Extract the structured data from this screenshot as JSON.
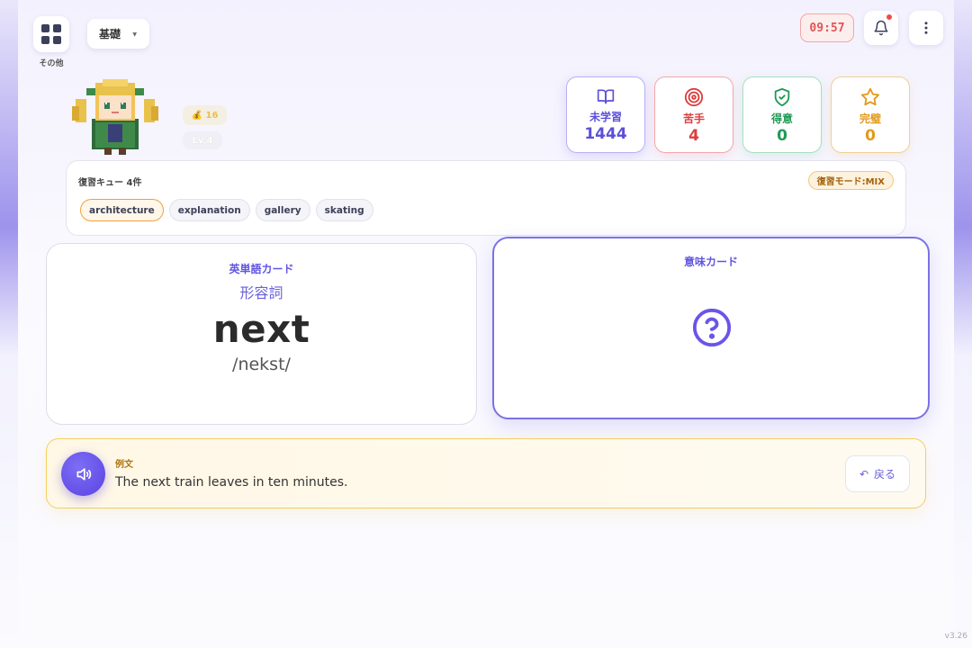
{
  "topbar": {
    "apps_label": "その他",
    "level": "基礎",
    "timer": "09:57"
  },
  "player": {
    "coins": "💰 16",
    "level": "Lv.4"
  },
  "stats": [
    {
      "label": "未学習",
      "value": "1444",
      "icon": "book-icon",
      "color": "#5b4fd8"
    },
    {
      "label": "苦手",
      "value": "4",
      "icon": "target-icon",
      "color": "#dc3d3d"
    },
    {
      "label": "得意",
      "value": "0",
      "icon": "shield-check-icon",
      "color": "#1f9a55"
    },
    {
      "label": "完璧",
      "value": "0",
      "icon": "star-icon",
      "color": "#e39a1a"
    }
  ],
  "queue": {
    "title": "復習キュー 4件",
    "mode": "復習モード:MIX",
    "words": [
      "architecture",
      "explanation",
      "gallery",
      "skating"
    ]
  },
  "word_card": {
    "heading": "英単語カード",
    "pos": "形容詞",
    "word": "next",
    "ipa": "/nekst/"
  },
  "meaning_card": {
    "heading": "意味カード"
  },
  "example": {
    "label": "例文",
    "text": "The next train leaves in ten minutes.",
    "back_label": "戻る"
  },
  "version": "v3.26",
  "colors": {
    "accent": "#6156e0",
    "timer": "#e05656"
  }
}
